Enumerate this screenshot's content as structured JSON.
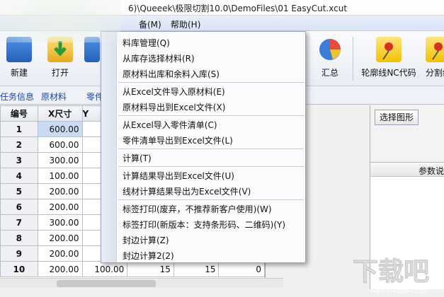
{
  "titlebar": {
    "path": "6)\\Queeek\\极限切割10.0\\DemoFiles\\01 EasyCut.xcut"
  },
  "menubar": {
    "items": [
      "备(M)",
      "帮助(H)"
    ]
  },
  "toolbar": {
    "buttons": [
      {
        "label": "新建",
        "icon": "new-icon",
        "color": "#3a7bd5"
      },
      {
        "label": "打开",
        "icon": "open-folder-icon",
        "color": "#f1c232"
      },
      {
        "label": "汇总",
        "icon": "pie-chart-icon",
        "color": "#e74c3c"
      },
      {
        "label": "轮廓线NC代码",
        "icon": "pin-icon",
        "color": "#f4d03f"
      },
      {
        "label": "分割线",
        "icon": "pin-icon",
        "color": "#f4d03f"
      }
    ]
  },
  "tabs": [
    "任务信息",
    "原材料",
    "零件"
  ],
  "grid": {
    "headers": [
      "编号",
      "X尺寸",
      "Y"
    ],
    "rows": [
      {
        "no": "1",
        "x": "600.00",
        "y": ""
      },
      {
        "no": "2",
        "x": "600.00",
        "y": ""
      },
      {
        "no": "3",
        "x": "300.00",
        "y": ""
      },
      {
        "no": "4",
        "x": "100.00",
        "y": ""
      },
      {
        "no": "5",
        "x": "200.00",
        "y": ""
      },
      {
        "no": "6",
        "x": "200.00",
        "y": ""
      },
      {
        "no": "7",
        "x": "300.00",
        "y": ""
      },
      {
        "no": "8",
        "x": "200.00",
        "y": ""
      },
      {
        "no": "9",
        "x": "200.00",
        "y": ""
      },
      {
        "no": "10",
        "x": "200.00",
        "y": "100.00",
        "c3": "15",
        "c4": "15",
        "c5": "0"
      }
    ]
  },
  "right_panel": {
    "select_shape": "选择图形",
    "header": "参数说"
  },
  "dropdown": {
    "items": [
      "料库管理(Q)",
      "从库存选择材料(R)",
      "原材料出库和余料入库(S)",
      "从Excel文件导入原材料(E)",
      "原材料导出到Excel文件(X)",
      "从Excel导入零件清单(C)",
      "零件清单导出到Excel文件(L)",
      "计算(T)",
      "计算结果导出到Excel文件(U)",
      "线材计算结果导出为Excel文件(V)",
      "标签打印(废弃，不推荐新客户使用)(W)",
      "标签打印(新版本：支持条形码、二维码)(Y)",
      "封边计算(Z)",
      "封边计算2(2)"
    ]
  },
  "watermark": {
    "text": "下载吧",
    "url": "www.xiazaiba.com"
  }
}
